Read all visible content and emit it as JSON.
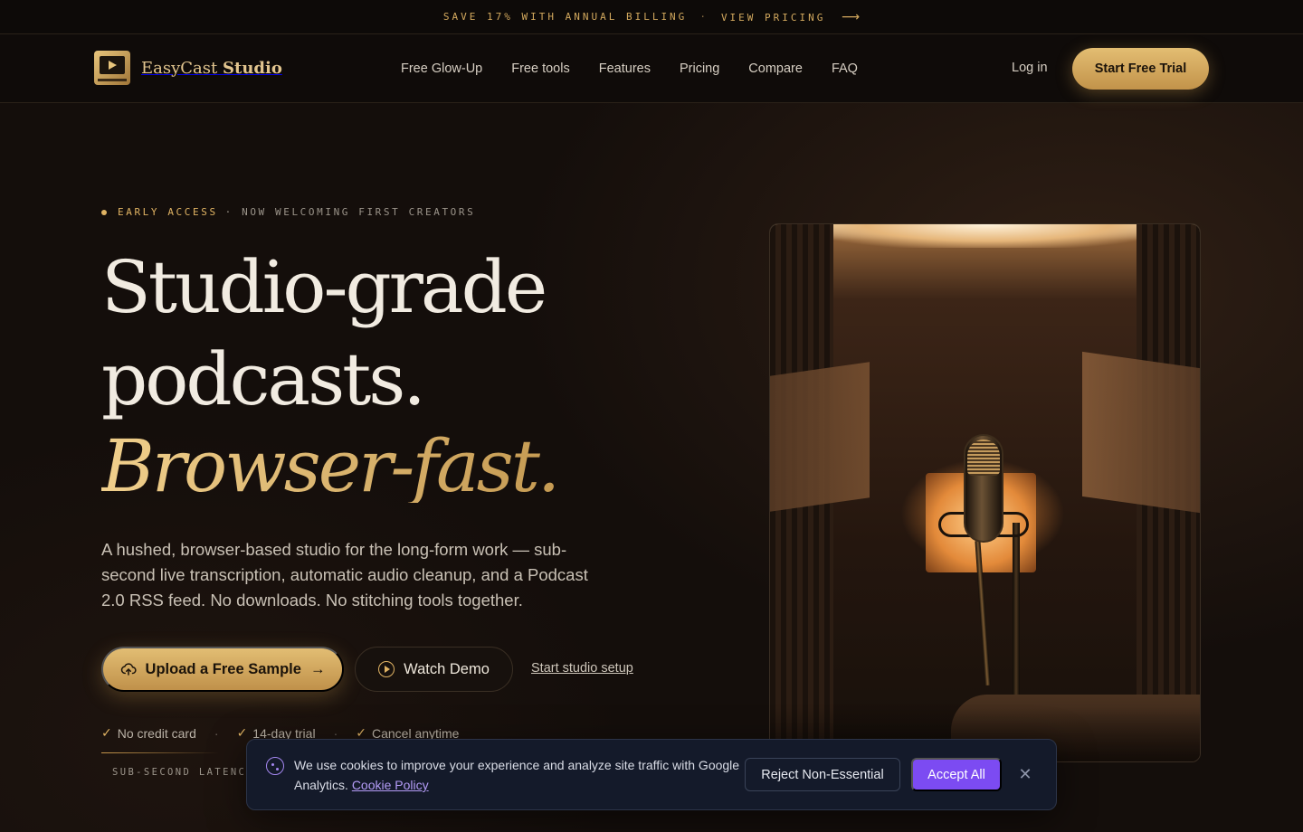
{
  "promo": {
    "text": "SAVE 17% WITH ANNUAL BILLING",
    "separator": "·",
    "link": "VIEW PRICING",
    "arrow": "⟶"
  },
  "nav": {
    "brand_prefix": "EasyCast",
    "brand_suffix": "Studio",
    "links": [
      "Free Glow-Up",
      "Free tools",
      "Features",
      "Pricing",
      "Compare",
      "FAQ"
    ],
    "login": "Log in",
    "cta": "Start Free Trial"
  },
  "hero": {
    "eyebrow_accent": "EARLY ACCESS",
    "eyebrow_rest": "· NOW WELCOMING FIRST CREATORS",
    "headline_1": "Studio-grade",
    "headline_2": "podcasts.",
    "headline_3": "Browser-fast.",
    "lede": "A hushed, browser-based studio for the long-form work — sub-second live transcription, automatic audio cleanup, and a Podcast 2.0 RSS feed. No downloads. No stitching tools together.",
    "upload_label": "Upload a Free Sample",
    "upload_arrow": "→",
    "demo_label": "Watch Demo",
    "studio_link": "Start studio setup",
    "checks": [
      "No credit card",
      "14-day trial",
      "Cancel anytime"
    ],
    "check_glyph": "✓",
    "check_sep": "·",
    "latency": "SUB-SECOND LATENCY"
  },
  "cookie": {
    "text": "We use cookies to improve your experience and analyze site traffic with Google Analytics.",
    "policy_link": "Cookie Policy",
    "reject": "Reject Non-Essential",
    "accept": "Accept All",
    "close": "✕"
  },
  "colors": {
    "accent_gold": "#e0b363",
    "accept_purple": "#7c4bf2",
    "background": "#140e0b"
  }
}
